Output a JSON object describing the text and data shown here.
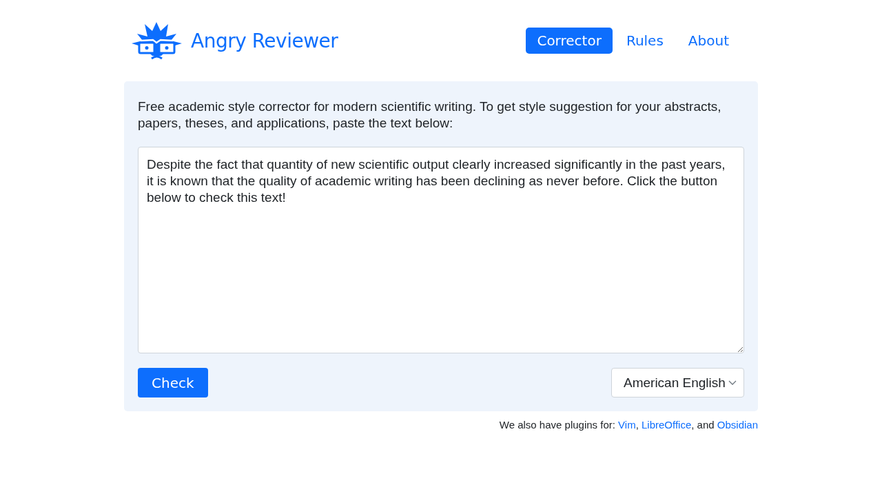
{
  "header": {
    "brand": "Angry Reviewer",
    "nav": [
      {
        "label": "Corrector",
        "selected": true
      },
      {
        "label": "Rules",
        "selected": false
      },
      {
        "label": "About",
        "selected": false
      }
    ]
  },
  "panel": {
    "intro": "Free academic style corrector for modern scientific writing. To get style suggestion for your abstracts, papers, theses, and applications, paste the text below:",
    "text_input": {
      "value": "Despite the fact that quantity of new scientific output clearly increased significantly in the past years, it is known that the quality of academic writing has been declining as never before. Click the button below to check this text!"
    },
    "check_button": "Check",
    "language_select": {
      "value": "American English"
    }
  },
  "footer": {
    "parts": [
      {
        "kind": "text",
        "text": "We also have plugins for: "
      },
      {
        "kind": "link",
        "text": "Vim"
      },
      {
        "kind": "text",
        "text": ", "
      },
      {
        "kind": "link",
        "text": "LibreOffice"
      },
      {
        "kind": "text",
        "text": ", and "
      },
      {
        "kind": "link",
        "text": "Obsidian"
      }
    ]
  }
}
